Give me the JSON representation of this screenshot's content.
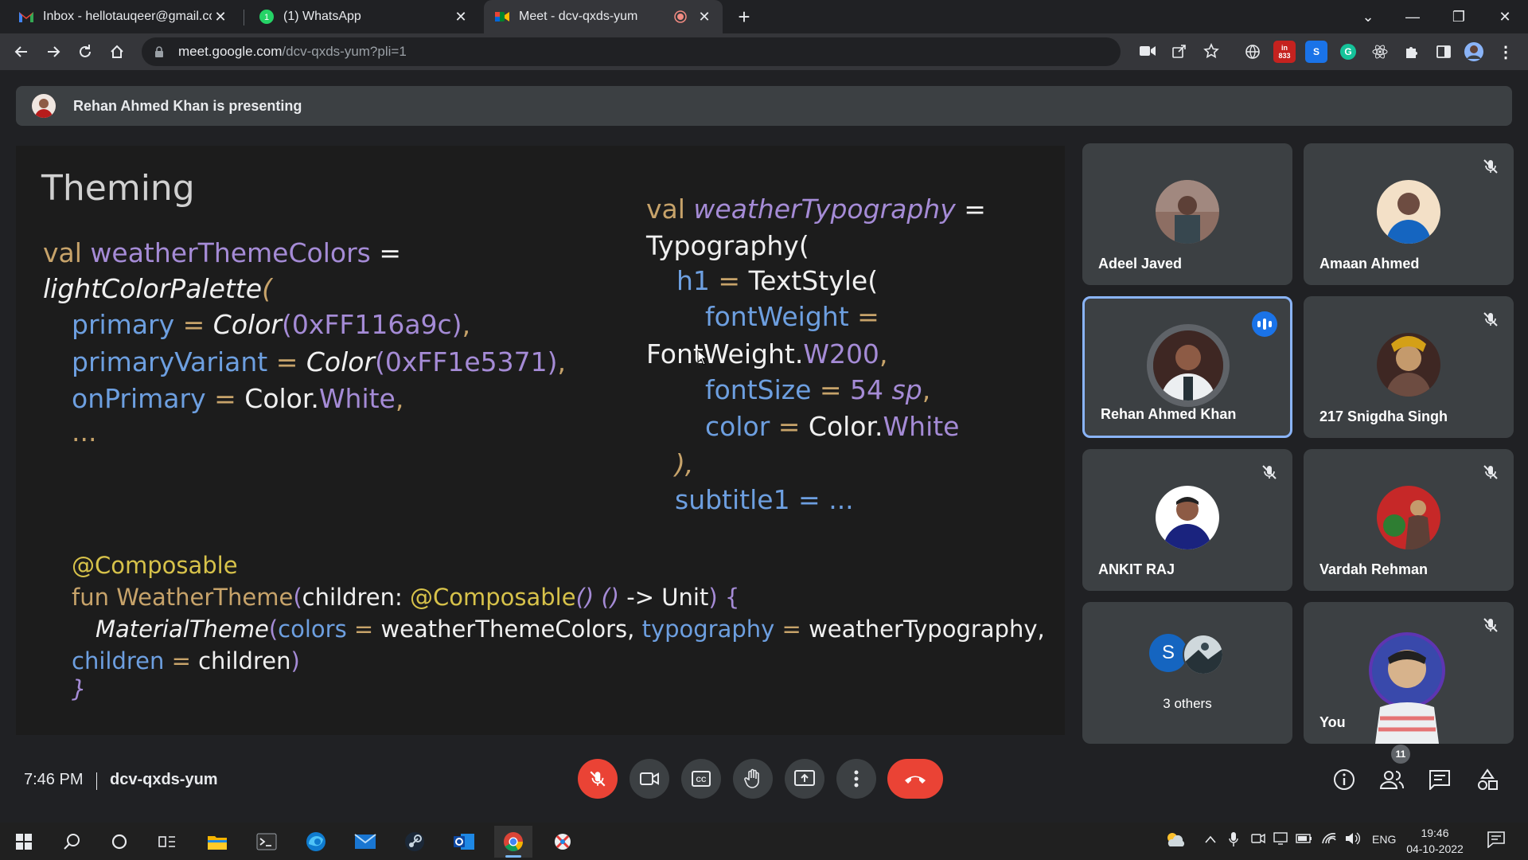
{
  "browser": {
    "tabs": [
      {
        "label": "Inbox - hellotauqeer@gmail.com",
        "icon": "gmail-icon"
      },
      {
        "label": "(1) WhatsApp",
        "icon": "whatsapp-icon"
      },
      {
        "label": "Meet - dcv-qxds-yum",
        "icon": "meet-icon",
        "active": true
      }
    ],
    "url_host": "meet.google.com",
    "url_path": "/dcv-qxds-yum?pli=1",
    "extension_badge": "833"
  },
  "meet": {
    "presenting_banner": "Rehan Ahmed Khan is presenting",
    "slide": {
      "title": "Theming",
      "left_code": {
        "l1_kw": "val ",
        "l1_name": "weatherThemeColors",
        "l1_eq": " =",
        "l2_fn": "lightColorPalette",
        "l2_paren": "(",
        "l3_key": "primary",
        "l3_eq": " = ",
        "l3_fn": "Color",
        "l3_val": "(0xFF116a9c)",
        "l3_tail": ",",
        "l4_key": "primaryVariant",
        "l4_eq": " = ",
        "l4_fn": "Color",
        "l4_val": "(0xFF1e5371)",
        "l4_tail": ",",
        "l5_key": "onPrimary",
        "l5_eq": " = ",
        "l5_obj": "Color.",
        "l5_val": "White",
        "l5_tail": ",",
        "l6": "..."
      },
      "right_code": {
        "r1_kw": "val ",
        "r1_name": "weatherTypography",
        "r1_eq": " =",
        "r2": "Typography(",
        "r3_key": "h1",
        "r3_eq": " = ",
        "r3_fn": "TextStyle(",
        "r4_key": "fontWeight",
        "r4_eq": " =",
        "r5_obj": "FontWeight.",
        "r5_val": "W200",
        "r5_tail": ",",
        "r6_key": "fontSize",
        "r6_eq": " = ",
        "r6_num": "54",
        "r6_unit": " sp",
        "r6_tail": ",",
        "r7_key": "color",
        "r7_eq": " = ",
        "r7_obj": "Color.",
        "r7_val": "White",
        "r8": "),",
        "r9": "subtitle1 = ..."
      },
      "bottom_code": {
        "b1": "@Composable",
        "b2_kw": "fun ",
        "b2_name": "WeatherTheme",
        "b2_open": "(",
        "b2_param": "children: ",
        "b2_ann": "@Composable",
        "b2_fn": "() () ",
        "b2_ret": "-> Unit",
        "b2_close": ") {",
        "b3_fn": "MaterialTheme",
        "b3_open": "(",
        "b3_k1": "colors",
        "b3_eq1": " = ",
        "b3_v1": "weatherThemeColors, ",
        "b3_k2": "typography",
        "b3_eq2": " = ",
        "b3_v2": "weatherTypography,",
        "b4_key": "children",
        "b4_eq": " = ",
        "b4_val": "children",
        "b4_close": ")",
        "b5": "}"
      }
    },
    "participants": [
      {
        "name": "Adeel Javed",
        "muted": false
      },
      {
        "name": "Amaan Ahmed",
        "muted": true
      },
      {
        "name": "Rehan Ahmed Khan",
        "muted": false,
        "speaking": true
      },
      {
        "name": "217 Snigdha Singh",
        "muted": true
      },
      {
        "name": "ANKIT RAJ",
        "muted": true
      },
      {
        "name": "Vardah Rehman",
        "muted": true
      },
      {
        "name": "3 others",
        "initial": "S"
      },
      {
        "name": "You",
        "muted": true
      }
    ],
    "time": "7:46 PM",
    "meeting_code": "dcv-qxds-yum",
    "participant_count": "11",
    "colors": {
      "accent": "#8ab4f8",
      "end_call": "#ea4335",
      "speaking": "#1a73e8"
    }
  },
  "taskbar": {
    "lang": "ENG",
    "time": "19:46",
    "date": "04-10-2022"
  }
}
